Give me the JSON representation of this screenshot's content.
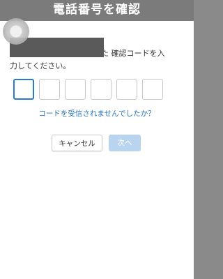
{
  "header": {
    "title": "電話番号を確認"
  },
  "dialog": {
    "instruction_line1": "信された 確認コードを入",
    "instruction_line2": "力してください。",
    "code_boxes": [
      "",
      "",
      "",
      "",
      "",
      ""
    ],
    "resend_link": "コードを受信されませんでしたか？",
    "cancel_label": "キャンセル",
    "next_label": "次へ"
  },
  "colors": {
    "accent": "#2b7bc9",
    "link": "#2875c5",
    "next_disabled": "#b9d4ef"
  }
}
